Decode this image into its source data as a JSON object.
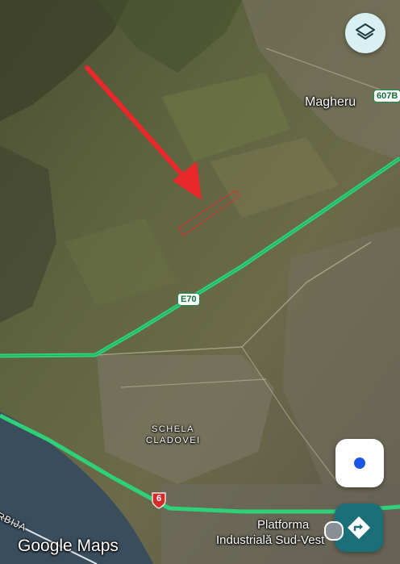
{
  "places": {
    "magheru": "Magheru",
    "schela_line1": "SCHELA",
    "schela_line2": "CLADOVEI",
    "platforma_line1": "Platforma",
    "platforma_line2": "Industrială Sud-Vest",
    "srbija": "RBIJA"
  },
  "road_shields": {
    "e70": "E70",
    "r607b": "607B",
    "r6": "6"
  },
  "branding": {
    "logo": "Google Maps"
  },
  "icons": {
    "layers": "layers-icon",
    "my_location": "my-location-icon",
    "directions": "directions-icon",
    "arrow": "red-arrow-icon"
  },
  "colors": {
    "highway": "#2fd07a",
    "water": "#3a4d5c",
    "arrow": "#e8282a",
    "fab_teal": "#1b6f79",
    "location_blue": "#1a55e8"
  }
}
